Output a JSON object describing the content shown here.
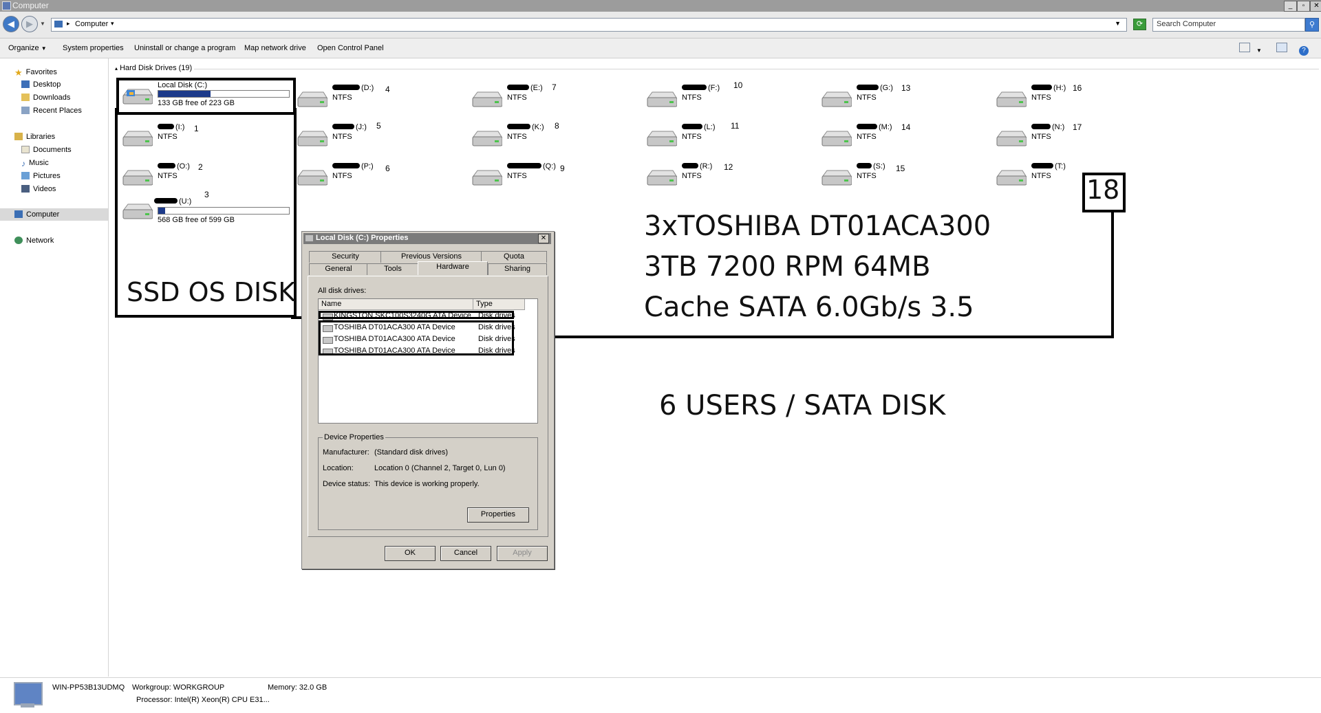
{
  "window": {
    "title": "Computer"
  },
  "address": {
    "location": "Computer",
    "search_placeholder": "Search Computer"
  },
  "toolbar": {
    "organize": "Organize",
    "system_properties": "System properties",
    "uninstall": "Uninstall or change a program",
    "map_drive": "Map network drive",
    "control_panel": "Open Control Panel"
  },
  "nav": {
    "favorites": "Favorites",
    "desktop": "Desktop",
    "downloads": "Downloads",
    "recent": "Recent Places",
    "libraries": "Libraries",
    "documents": "Documents",
    "music": "Music",
    "pictures": "Pictures",
    "videos": "Videos",
    "computer": "Computer",
    "network": "Network"
  },
  "group": {
    "header": "Hard Disk Drives (19)"
  },
  "drives": {
    "c": {
      "name": "Local Disk (C:)",
      "free": "133 GB free of 223 GB",
      "used_fraction": 0.4
    },
    "d": {
      "letter": "(D:)",
      "fs": "NTFS",
      "num": "4"
    },
    "e": {
      "letter": "(E:)",
      "fs": "NTFS",
      "num": "7"
    },
    "f": {
      "letter": "(F:)",
      "fs": "NTFS",
      "num": "10"
    },
    "g": {
      "letter": "(G:)",
      "fs": "NTFS",
      "num": "13"
    },
    "h": {
      "letter": "(H:)",
      "fs": "NTFS",
      "num": "16"
    },
    "i": {
      "letter": "(I:)",
      "fs": "NTFS",
      "num": "1"
    },
    "j": {
      "letter": "(J:)",
      "fs": "NTFS",
      "num": "5"
    },
    "k": {
      "letter": "(K:)",
      "fs": "NTFS",
      "num": "8"
    },
    "l": {
      "letter": "(L:)",
      "fs": "NTFS",
      "num": "11"
    },
    "m": {
      "letter": "(M:)",
      "fs": "NTFS",
      "num": "14"
    },
    "n": {
      "letter": "(N:)",
      "fs": "NTFS",
      "num": "17"
    },
    "o": {
      "letter": "(O:)",
      "fs": "NTFS",
      "num": "2"
    },
    "p": {
      "letter": "(P:)",
      "fs": "NTFS",
      "num": "6"
    },
    "q": {
      "letter": "(Q:)",
      "fs": "NTFS",
      "num": "9"
    },
    "r": {
      "letter": "(R:)",
      "fs": "NTFS",
      "num": "12"
    },
    "s": {
      "letter": "(S:)",
      "fs": "NTFS",
      "num": "15"
    },
    "t": {
      "letter": "(T:)",
      "fs": "NTFS"
    },
    "u": {
      "letter": "(U:)",
      "free": "568 GB free of 599 GB",
      "num": "3",
      "used_fraction": 0.05
    }
  },
  "annotations": {
    "ssd": "SSD OS DISK",
    "count": "18",
    "hdd_line1": "3xTOSHIBA DT01ACA300",
    "hdd_line2": "3TB 7200 RPM 64MB",
    "hdd_line3": "Cache SATA 6.0Gb/s 3.5",
    "users": "6 USERS / SATA DISK"
  },
  "dialog": {
    "title": "Local Disk (C:) Properties",
    "tabs": {
      "security": "Security",
      "previous_versions": "Previous Versions",
      "quota": "Quota",
      "general": "General",
      "tools": "Tools",
      "hardware": "Hardware",
      "sharing": "Sharing"
    },
    "all_disk_drives": "All disk drives:",
    "col_name": "Name",
    "col_type": "Type",
    "rows": [
      {
        "name": "KINGSTON SKC100S3240G ATA Device",
        "type": "Disk drives"
      },
      {
        "name": "TOSHIBA DT01ACA300 ATA Device",
        "type": "Disk drives"
      },
      {
        "name": "TOSHIBA DT01ACA300 ATA Device",
        "type": "Disk drives"
      },
      {
        "name": "TOSHIBA DT01ACA300 ATA Device",
        "type": "Disk drives"
      }
    ],
    "device_properties": "Device Properties",
    "manufacturer_label": "Manufacturer:",
    "manufacturer": "(Standard disk drives)",
    "location_label": "Location:",
    "location": "Location 0 (Channel 2, Target 0, Lun 0)",
    "status_label": "Device status:",
    "status": "This device is working properly.",
    "properties_btn": "Properties",
    "ok": "OK",
    "cancel": "Cancel",
    "apply": "Apply"
  },
  "details": {
    "computer_name": "WIN-PP53B13UDMQ",
    "workgroup": "Workgroup: WORKGROUP",
    "memory": "Memory: 32.0 GB",
    "processor": "Processor: Intel(R) Xeon(R) CPU E31..."
  }
}
